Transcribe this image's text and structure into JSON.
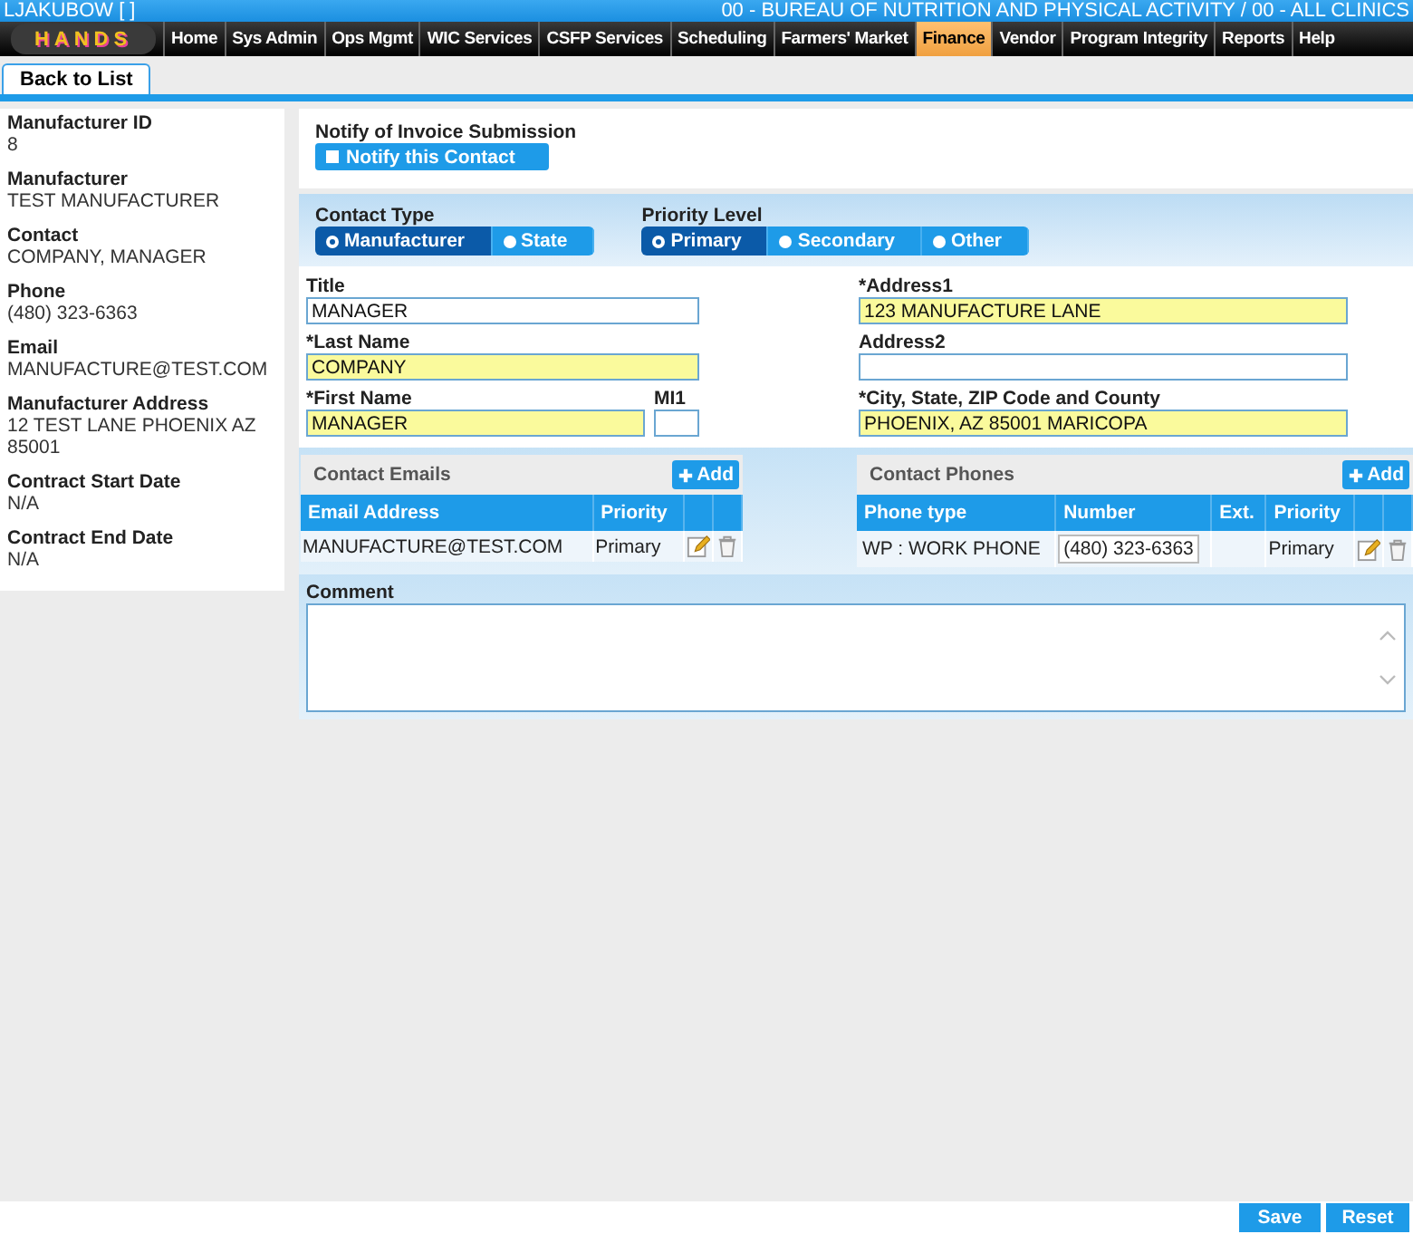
{
  "header": {
    "user": "LJAKUBOW [ ]",
    "agency": "00 - BUREAU OF NUTRITION AND PHYSICAL ACTIVITY / 00 - ALL CLINICS"
  },
  "nav": {
    "logo": "HANDS",
    "items": [
      {
        "label": "Home",
        "selected": false
      },
      {
        "label": "Sys Admin",
        "selected": false
      },
      {
        "label": "Ops Mgmt",
        "selected": false
      },
      {
        "label": "WIC Services",
        "selected": false
      },
      {
        "label": "CSFP Services",
        "selected": false
      },
      {
        "label": "Scheduling",
        "selected": false
      },
      {
        "label": "Farmers' Market",
        "selected": false
      },
      {
        "label": "Finance",
        "selected": true
      },
      {
        "label": "Vendor",
        "selected": false
      },
      {
        "label": "Program Integrity",
        "selected": false
      },
      {
        "label": "Reports",
        "selected": false
      },
      {
        "label": "Help",
        "selected": false
      }
    ]
  },
  "toolbar": {
    "back_button": "Back to List"
  },
  "details": [
    {
      "label": "Manufacturer ID",
      "value": "8"
    },
    {
      "label": "Manufacturer",
      "value": "TEST MANUFACTURER"
    },
    {
      "label": "Contact",
      "value": "COMPANY, MANAGER"
    },
    {
      "label": "Phone",
      "value": "(480) 323-6363"
    },
    {
      "label": "Email",
      "value": "MANUFACTURE@TEST.COM"
    },
    {
      "label": "Manufacturer Address",
      "value": "12 TEST LANE PHOENIX AZ 85001"
    },
    {
      "label": "Contract Start Date",
      "value": "N/A"
    },
    {
      "label": "Contract End Date",
      "value": "N/A"
    }
  ],
  "notify": {
    "label": "Notify of Invoice Submission",
    "button": "Notify this Contact",
    "checked": false
  },
  "contact_type": {
    "label": "Contact Type",
    "options": [
      {
        "label": "Manufacturer",
        "selected": true
      },
      {
        "label": "State",
        "selected": false
      }
    ]
  },
  "priority_level": {
    "label": "Priority Level",
    "options": [
      {
        "label": "Primary",
        "selected": true
      },
      {
        "label": "Secondary",
        "selected": false
      },
      {
        "label": "Other",
        "selected": false
      }
    ]
  },
  "left_rows": [
    [
      {
        "label": "Title",
        "value": "MANAGER",
        "required": false
      }
    ],
    [
      {
        "label": "*Last Name",
        "value": "COMPANY",
        "required": true
      }
    ],
    [
      {
        "label": "*First Name",
        "value": "MANAGER",
        "required": true
      },
      {
        "label": "MI1",
        "required": false
      }
    ]
  ],
  "right_rows": [
    [
      {
        "label": "*Address1",
        "value": "123 MANUFACTURE LANE",
        "required": true
      }
    ],
    [
      {
        "label": "Address2",
        "required": false
      }
    ],
    [
      {
        "label": "*City, State, ZIP Code and County",
        "value": "PHOENIX, AZ 85001 MARICOPA",
        "required": true
      }
    ]
  ],
  "emails": {
    "title": "Contact Emails",
    "add_button": "Add",
    "columns": [
      "Email Address",
      "Priority"
    ],
    "rows": [
      {
        "email": "MANUFACTURE@TEST.COM",
        "priority": "Primary"
      }
    ]
  },
  "phones": {
    "title": "Contact Phones",
    "add_button": "Add",
    "columns": [
      "Phone type",
      "Number",
      "Ext.",
      "Priority"
    ],
    "rows": [
      {
        "phone_type": "WP : WORK PHONE",
        "number": "(480) 323-6363",
        "priority": "Primary"
      }
    ]
  },
  "comment": {
    "label": "Comment"
  },
  "footer": {
    "buttons": [
      "Save",
      "Reset"
    ]
  }
}
